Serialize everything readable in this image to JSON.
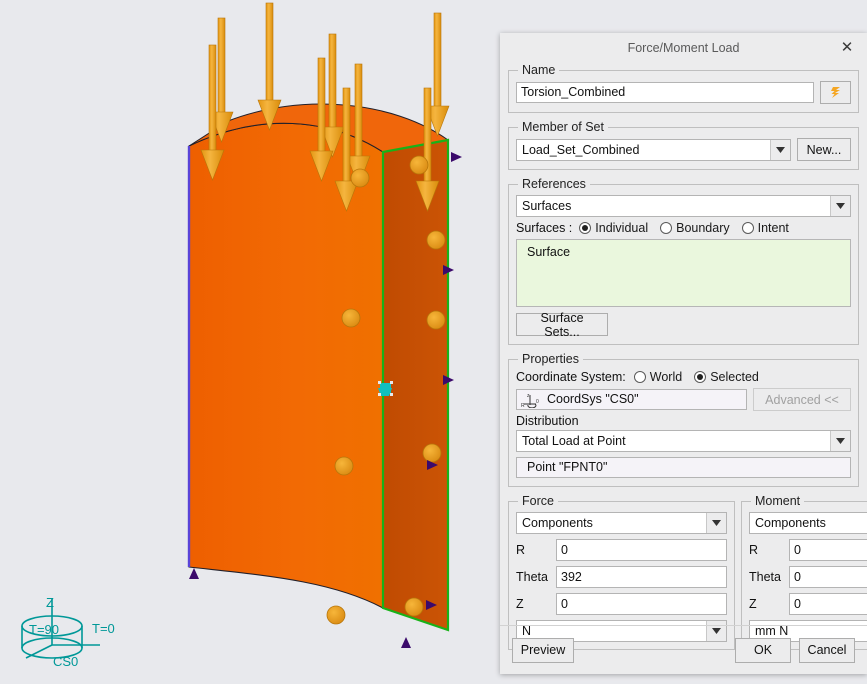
{
  "viewport": {
    "triad": {
      "z_label": "Z",
      "t90_label": "T=90",
      "t0_label": "T=0",
      "cs_label": "CS0",
      "color": "#009898"
    },
    "model": {
      "front_face_color": "#F26100",
      "side_face_color": "#C44F04",
      "selected_edge_color": "#19B219",
      "load_arrow_color": "#F0A422",
      "constraint_marker_color": "#3B0A6B",
      "point_marker_color": "#11BFBF"
    }
  },
  "dialog": {
    "title": "Force/Moment Load",
    "close_icon": "close-icon",
    "name": {
      "legend": "Name",
      "value": "Torsion_Combined",
      "icon_button": "load-type-icon"
    },
    "member_of_set": {
      "legend": "Member of Set",
      "value": "Load_Set_Combined",
      "new_button": "New..."
    },
    "references": {
      "legend": "References",
      "type_value": "Surfaces",
      "surfaces_label": "Surfaces :",
      "options": [
        {
          "label": "Individual",
          "selected": true
        },
        {
          "label": "Boundary",
          "selected": false
        },
        {
          "label": "Intent",
          "selected": false
        }
      ],
      "list_items": [
        "Surface"
      ],
      "sets_button": "Surface Sets..."
    },
    "properties": {
      "legend": "Properties",
      "coordinate_system_label": "Coordinate System:",
      "cs_options": [
        {
          "label": "World",
          "selected": false
        },
        {
          "label": "Selected",
          "selected": true
        }
      ],
      "cs_value": "CoordSys \"CS0\"",
      "advanced_button": "Advanced <<",
      "distribution_label": "Distribution",
      "distribution_value": "Total Load at Point",
      "point_value": "Point \"FPNT0\""
    },
    "force": {
      "legend": "Force",
      "mode": "Components",
      "fields": [
        {
          "name": "R",
          "value": "0"
        },
        {
          "name": "Theta",
          "value": "392"
        },
        {
          "name": "Z",
          "value": "0"
        }
      ],
      "units": "N"
    },
    "moment": {
      "legend": "Moment",
      "mode": "Components",
      "fields": [
        {
          "name": "R",
          "value": "0"
        },
        {
          "name": "Theta",
          "value": "0"
        },
        {
          "name": "Z",
          "value": "0"
        }
      ],
      "units": "mm N"
    },
    "footer": {
      "preview": "Preview",
      "ok": "OK",
      "cancel": "Cancel"
    }
  }
}
